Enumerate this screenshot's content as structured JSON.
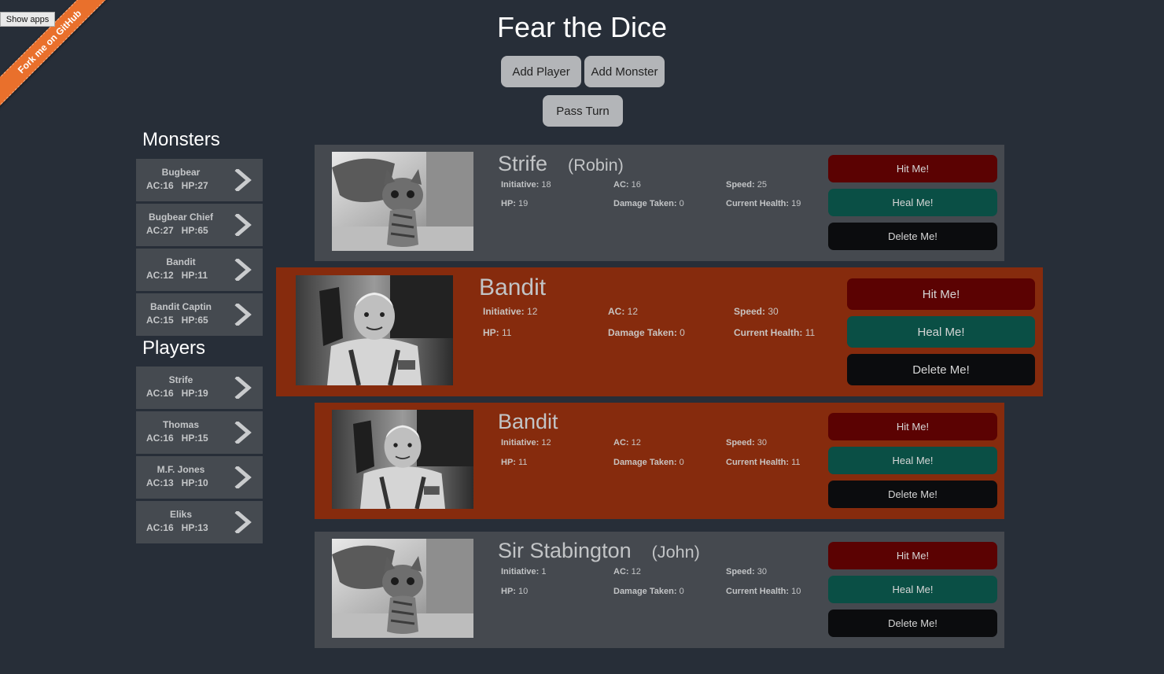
{
  "ui": {
    "show_apps": "Show apps",
    "ribbon": "Fork me on GitHub",
    "title": "Fear the Dice",
    "add_player": "Add Player",
    "add_monster": "Add Monster",
    "pass_turn": "Pass Turn"
  },
  "sidebar": {
    "monsters_title": "Monsters",
    "players_title": "Players",
    "monsters": [
      {
        "name": "Bugbear",
        "stats": "AC:16   HP:27"
      },
      {
        "name": "Bugbear Chief",
        "stats": "AC:27   HP:65"
      },
      {
        "name": "Bandit",
        "stats": "AC:12   HP:11"
      },
      {
        "name": "Bandit Captin",
        "stats": "AC:15   HP:65"
      }
    ],
    "players": [
      {
        "name": "Strife",
        "stats": "AC:16   HP:19"
      },
      {
        "name": "Thomas",
        "stats": "AC:16   HP:15"
      },
      {
        "name": "M.F. Jones",
        "stats": "AC:13   HP:10"
      },
      {
        "name": "Eliks",
        "stats": "AC:16   HP:13"
      }
    ]
  },
  "labels": {
    "initiative": "Initiative:",
    "ac": "AC:",
    "speed": "Speed:",
    "hp": "HP:",
    "damage": "Damage Taken:",
    "current": "Current Health:",
    "hit": "Hit Me!",
    "heal": "Heal Me!",
    "delete": "Delete Me!"
  },
  "cards": [
    {
      "name": "Strife",
      "player": "(Robin)",
      "image": "kitten-photo",
      "initiative": "18",
      "ac": "16",
      "speed": "25",
      "hp": "19",
      "damage": "0",
      "current": "19"
    },
    {
      "name": "Bandit",
      "player": "",
      "image": "ghostbuster-photo",
      "initiative": "12",
      "ac": "12",
      "speed": "30",
      "hp": "11",
      "damage": "0",
      "current": "11"
    },
    {
      "name": "Bandit",
      "player": "",
      "image": "ghostbuster-photo",
      "initiative": "12",
      "ac": "12",
      "speed": "30",
      "hp": "11",
      "damage": "0",
      "current": "11"
    },
    {
      "name": "Sir Stabington",
      "player": "(John)",
      "image": "kitten-photo",
      "initiative": "1",
      "ac": "12",
      "speed": "30",
      "hp": "10",
      "damage": "0",
      "current": "10"
    }
  ],
  "colors": {
    "background": "#272e38",
    "card_grey": "#45494f",
    "card_active": "#862b0d",
    "hit": "#5b0202",
    "heal": "#0a4f45",
    "delete": "#0b0c0e",
    "ribbon": "#e9702c"
  },
  "icons": {
    "sidebar_arrow": "chevron-right-icon"
  }
}
